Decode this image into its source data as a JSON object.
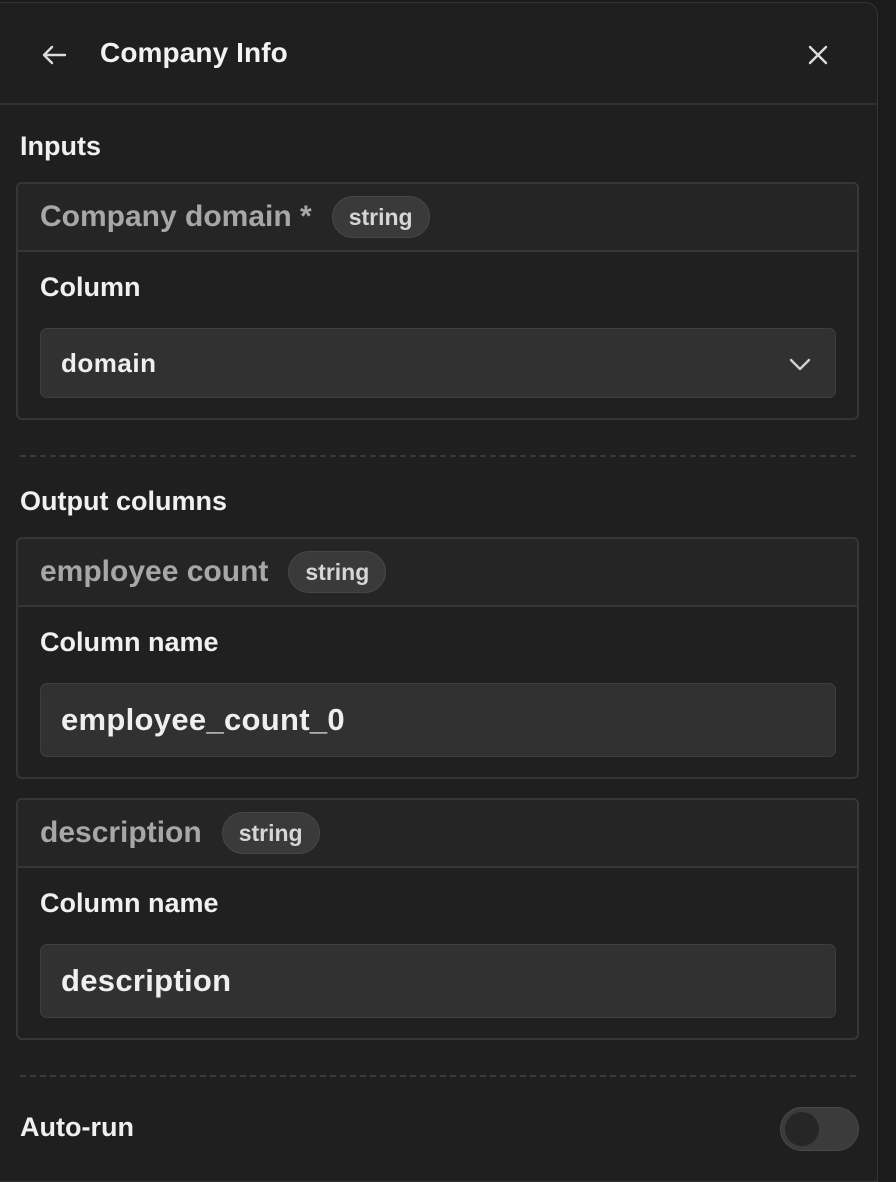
{
  "header": {
    "title": "Company Info",
    "back_icon": "arrow-left-icon",
    "close_icon": "close-icon"
  },
  "inputs": {
    "section_title": "Inputs",
    "company_domain": {
      "name": "Company domain *",
      "type_badge": "string",
      "field_label": "Column",
      "selected_value": "domain",
      "dropdown_icon": "chevron-down-icon"
    }
  },
  "outputs": {
    "section_title": "Output columns",
    "columns": [
      {
        "name": "employee count",
        "type_badge": "string",
        "field_label": "Column name",
        "value": "employee_count_0"
      },
      {
        "name": "description",
        "type_badge": "string",
        "field_label": "Column name",
        "value": "description"
      }
    ]
  },
  "autorun": {
    "label": "Auto-run",
    "enabled": false
  },
  "colors": {
    "background": "#1b1b1b",
    "panel": "#1f1f1f",
    "card_header": "#252525",
    "input_bg": "#313131",
    "text_primary": "#f0f0f0",
    "text_muted": "#a7a7a7"
  }
}
